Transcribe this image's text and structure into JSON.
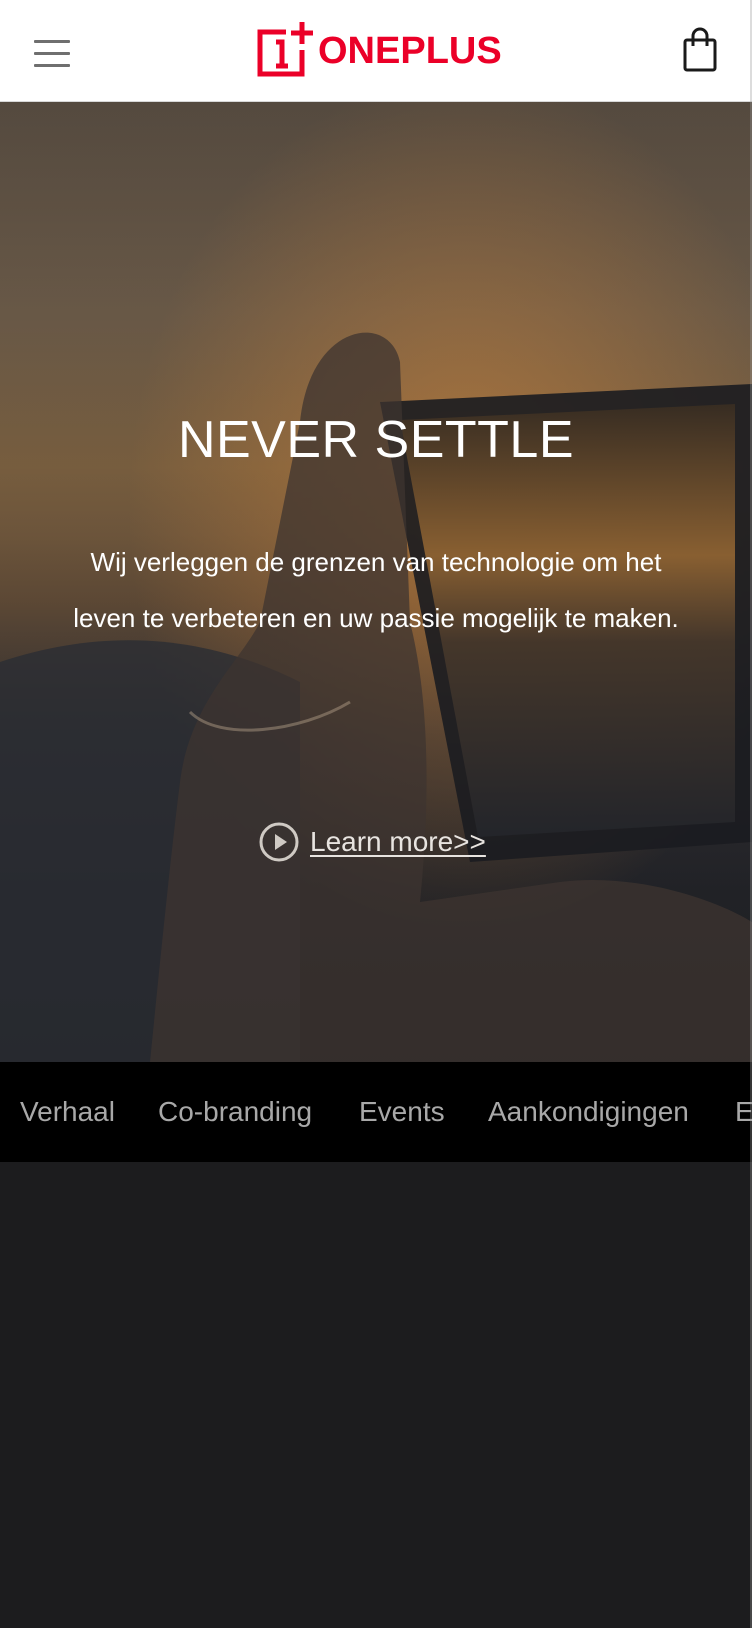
{
  "header": {
    "brand": "ONEPLUS",
    "brand_color": "#eb0028",
    "menu_icon": "hamburger-menu-icon",
    "cart_icon": "shopping-bag-icon"
  },
  "hero": {
    "title": "NEVER SETTLE",
    "description": "Wij verleggen de grenzen van technologie om het leven te verbeteren en uw passie mogelijk te maken.",
    "cta_label": "Learn more>>",
    "cta_icon": "play-circle-icon"
  },
  "tabs": {
    "items": [
      {
        "label": "Verhaal"
      },
      {
        "label": "Co-branding"
      },
      {
        "label": "Events"
      },
      {
        "label": "Aankondigingen"
      },
      {
        "label": "E"
      }
    ]
  },
  "colors": {
    "header_bg": "#ffffff",
    "tabs_bg": "#000000",
    "tab_text": "#a8a8a8",
    "content_bg": "#1c1c1e"
  }
}
